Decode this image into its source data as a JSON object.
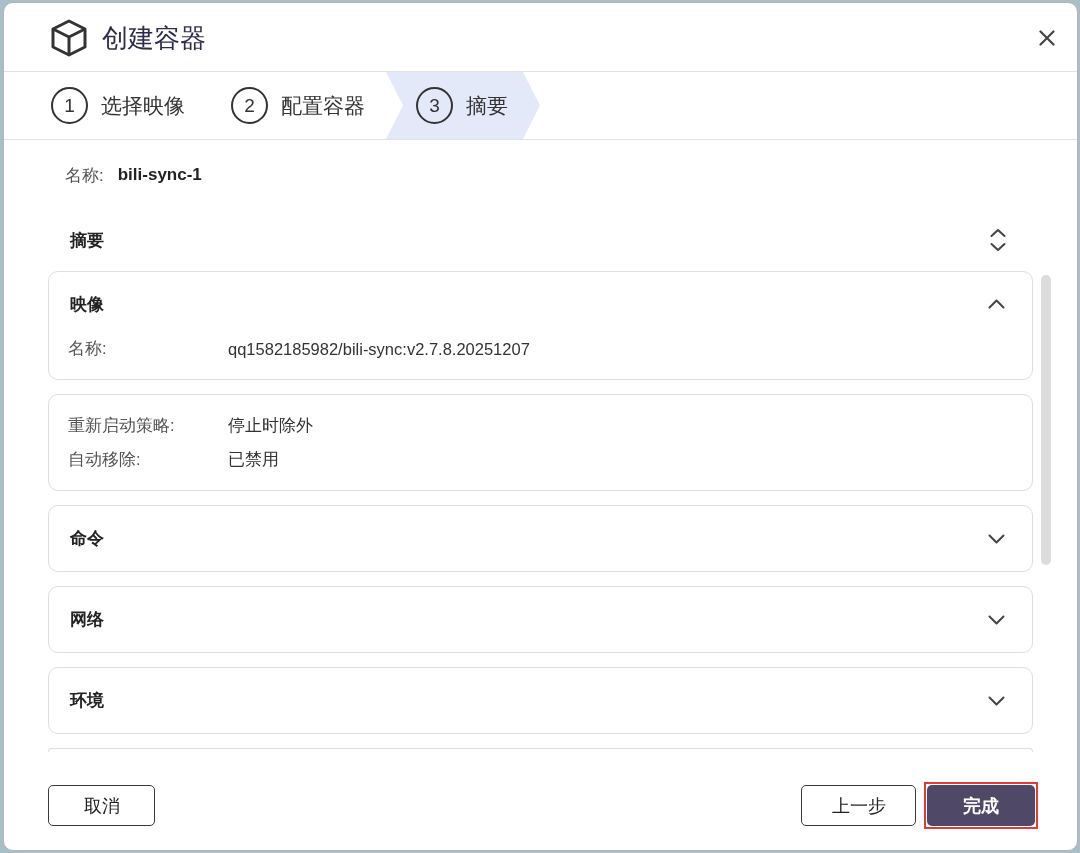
{
  "dialog": {
    "title": "创建容器"
  },
  "steps": [
    {
      "number": "1",
      "label": "选择映像",
      "selected": false
    },
    {
      "number": "2",
      "label": "配置容器",
      "selected": false
    },
    {
      "number": "3",
      "label": "摘要",
      "selected": true
    }
  ],
  "name_field": {
    "label": "名称:",
    "value": "bili-sync-1"
  },
  "summary": {
    "title": "摘要",
    "sections": [
      {
        "kind": "titled",
        "title": "映像",
        "expanded": true,
        "rows": [
          {
            "label": "名称:",
            "value": "qq1582185982/bili-sync:v2.7.8.20251207"
          }
        ]
      },
      {
        "kind": "untitled",
        "rows": [
          {
            "label": "重新启动策略:",
            "value": "停止时除外"
          },
          {
            "label": "自动移除:",
            "value": "已禁用"
          }
        ]
      },
      {
        "kind": "titled",
        "title": "命令",
        "expanded": false
      },
      {
        "kind": "titled",
        "title": "网络",
        "expanded": false
      },
      {
        "kind": "titled",
        "title": "环境",
        "expanded": false
      },
      {
        "kind": "cut_off"
      }
    ]
  },
  "footer": {
    "cancel": {
      "label": "取消",
      "kind": "secondary"
    },
    "back": {
      "label": "上一步",
      "kind": "secondary"
    },
    "finish": {
      "label": "完成",
      "kind": "primary",
      "highlighted": true
    }
  }
}
